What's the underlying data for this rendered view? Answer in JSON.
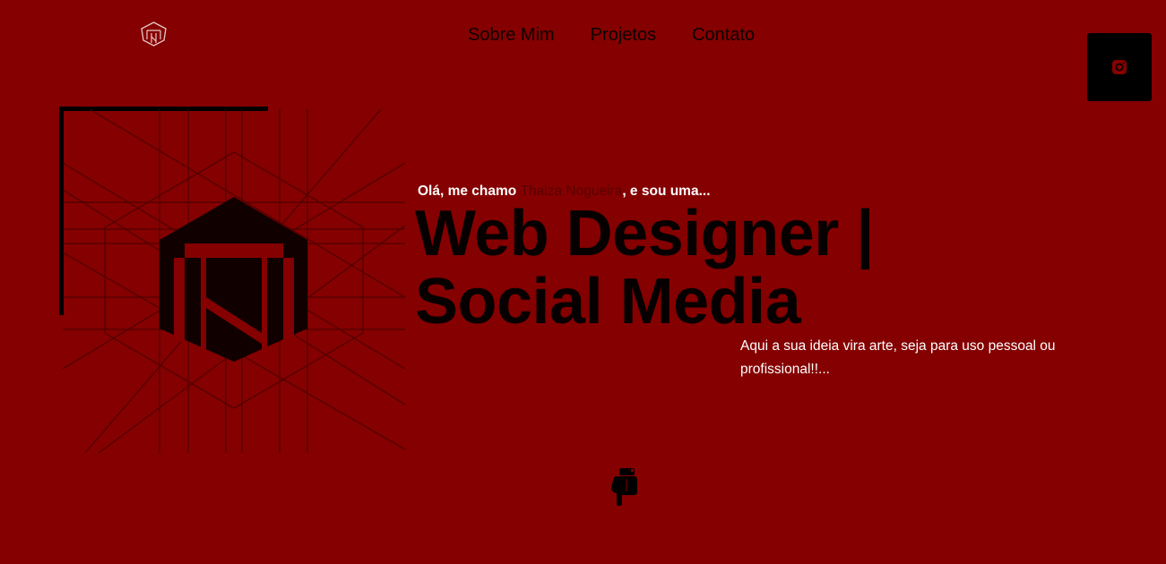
{
  "nav": {
    "items": [
      {
        "label": "Sobre Mim"
      },
      {
        "label": "Projetos"
      },
      {
        "label": "Contato"
      }
    ]
  },
  "social": {
    "icon": "instagram-icon"
  },
  "hero": {
    "greeting_prefix": "Olá, me chamo ",
    "greeting_name": "Thaiza Nogueira",
    "greeting_suffix": ", e sou uma...",
    "headline_line1": "Web Designer |",
    "headline_line2": "Social Media",
    "tagline": "Aqui a sua ideia vira arte, seja para uso pessoal ou profissional!!..."
  },
  "colors": {
    "background": "#850000",
    "text_dark": "#070000",
    "text_light": "#ffffff",
    "name_accent": "#5a0000"
  }
}
